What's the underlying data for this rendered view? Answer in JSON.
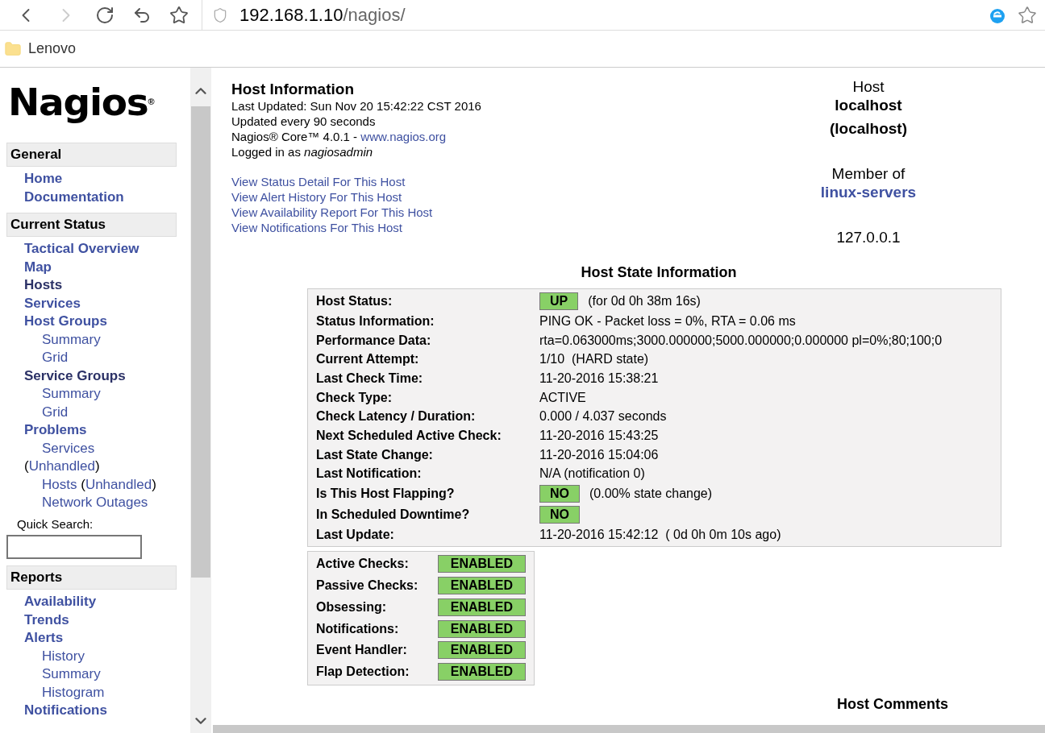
{
  "browser": {
    "url_host": "192.168.1.10",
    "url_path": "/nagios/",
    "bookmarks": [
      "Lenovo"
    ]
  },
  "sidebar": {
    "logo": "Nagios",
    "logo_mark": "®",
    "sections": [
      {
        "title": "General",
        "items": [
          {
            "label": "Home",
            "visited": false
          },
          {
            "label": "Documentation",
            "visited": false
          }
        ]
      },
      {
        "title": "Current Status",
        "items": [
          {
            "label": "Tactical Overview",
            "visited": false
          },
          {
            "label": "Map",
            "visited": false
          },
          {
            "label": "Hosts",
            "visited": true
          },
          {
            "label": "Services",
            "visited": false
          },
          {
            "label": "Host Groups",
            "visited": false,
            "children": [
              {
                "segments": [
                  {
                    "text": "Summary",
                    "link": true
                  }
                ]
              },
              {
                "segments": [
                  {
                    "text": "Grid",
                    "link": true
                  }
                ]
              }
            ]
          },
          {
            "label": "Service Groups",
            "visited": true,
            "children": [
              {
                "segments": [
                  {
                    "text": "Summary",
                    "link": true
                  }
                ]
              },
              {
                "segments": [
                  {
                    "text": "Grid",
                    "link": true
                  }
                ]
              }
            ]
          },
          {
            "label": "Problems",
            "visited": false,
            "children": [
              {
                "segments": [
                  {
                    "text": "Services",
                    "link": true
                  },
                  {
                    "text": "(",
                    "link": false
                  },
                  {
                    "text": "Unhandled",
                    "link": true
                  },
                  {
                    "text": ")",
                    "link": false
                  }
                ],
                "wrap": true
              },
              {
                "segments": [
                  {
                    "text": "Hosts",
                    "link": true
                  },
                  {
                    "text": "(",
                    "link": false
                  },
                  {
                    "text": "Unhandled",
                    "link": true
                  },
                  {
                    "text": ")",
                    "link": false
                  }
                ]
              },
              {
                "segments": [
                  {
                    "text": "Network Outages",
                    "link": true
                  }
                ]
              }
            ]
          }
        ]
      },
      {
        "title": "Reports",
        "items": [
          {
            "label": "Availability",
            "visited": false
          },
          {
            "label": "Trends",
            "visited": false
          },
          {
            "label": "Alerts",
            "visited": false,
            "children": [
              {
                "segments": [
                  {
                    "text": "History",
                    "link": true
                  }
                ]
              },
              {
                "segments": [
                  {
                    "text": "Summary",
                    "link": true
                  }
                ]
              },
              {
                "segments": [
                  {
                    "text": "Histogram",
                    "link": true
                  }
                ]
              }
            ]
          },
          {
            "label": "Notifications",
            "visited": false
          }
        ]
      }
    ],
    "quick_search": {
      "label": "Quick Search:"
    }
  },
  "info": {
    "title": "Host Information",
    "last_updated": "Last Updated: Sun Nov 20 15:42:22 CST 2016",
    "update_every": "Updated every 90 seconds",
    "core_text": "Nagios® Core™ 4.0.1 - ",
    "core_link": "www.nagios.org",
    "logged_in": "Logged in as *nagiosadmin*",
    "links": [
      "View Status Detail For This Host",
      "View Alert History For This Host",
      "View Availability Report For This Host",
      "View Notifications For This Host"
    ]
  },
  "host": {
    "heading": "Host",
    "name": "localhost",
    "alias": "(localhost)",
    "member_label": "Member of",
    "group": "linux-servers",
    "address": "127.0.0.1"
  },
  "state_info": {
    "title": "Host State Information",
    "rows": [
      {
        "label": "Host Status:",
        "kind": "badge",
        "badge": "UP",
        "color": "#88d066",
        "value": "(for 0d 0h 38m 16s)"
      },
      {
        "label": "Status Information:",
        "kind": "text",
        "value": "PING OK - Packet loss = 0%, RTA = 0.06 ms"
      },
      {
        "label": "Performance Data:",
        "kind": "text",
        "value": "rta=0.063000ms;3000.000000;5000.000000;0.000000 pl=0%;80;100;0"
      },
      {
        "label": "Current Attempt:",
        "kind": "text",
        "value": "1/10  (HARD state)"
      },
      {
        "label": "Last Check Time:",
        "kind": "text",
        "value": "11-20-2016 15:38:21"
      },
      {
        "label": "Check Type:",
        "kind": "text",
        "value": "ACTIVE"
      },
      {
        "label": "Check Latency / Duration:",
        "kind": "text",
        "value": "0.000 / 4.037 seconds"
      },
      {
        "label": "Next Scheduled Active Check:",
        "kind": "text",
        "value": "11-20-2016 15:43:25"
      },
      {
        "label": "Last State Change:",
        "kind": "text",
        "value": "11-20-2016 15:04:06"
      },
      {
        "label": "Last Notification:",
        "kind": "text",
        "value": "N/A (notification 0)"
      },
      {
        "label": "Is This Host Flapping?",
        "kind": "badge",
        "badge": "NO",
        "color": "#88d066",
        "value": "(0.00% state change)"
      },
      {
        "label": "In Scheduled Downtime?",
        "kind": "badge",
        "badge": "NO",
        "color": "#88d066"
      },
      {
        "label": "Last Update:",
        "kind": "text",
        "value": "11-20-2016 15:42:12  ( 0d 0h 0m 10s ago)"
      }
    ]
  },
  "checks": [
    {
      "label": "Active Checks:",
      "badge": "ENABLED",
      "color": "#88d066"
    },
    {
      "label": "Passive Checks:",
      "badge": "ENABLED",
      "color": "#88d066"
    },
    {
      "label": "Obsessing:",
      "badge": "ENABLED",
      "color": "#88d066"
    },
    {
      "label": "Notifications:",
      "badge": "ENABLED",
      "color": "#88d066"
    },
    {
      "label": "Event Handler:",
      "badge": "ENABLED",
      "color": "#88d066"
    },
    {
      "label": "Flap Detection:",
      "badge": "ENABLED",
      "color": "#88d066"
    }
  ],
  "comments": {
    "title": "Host Comments"
  }
}
